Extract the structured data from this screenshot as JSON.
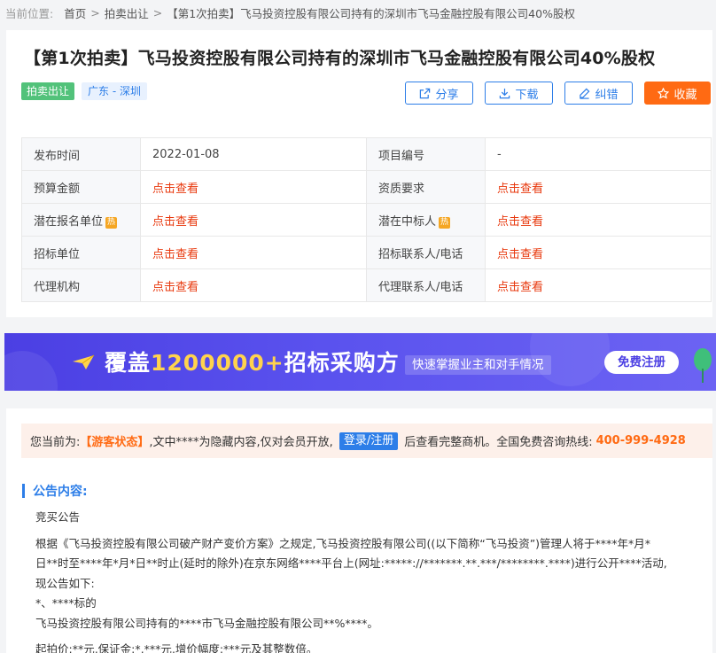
{
  "breadcrumb": {
    "label": "当前位置:",
    "home": "首页",
    "category": "拍卖出让",
    "current": "【第1次拍卖】飞马投资控股有限公司持有的深圳市飞马金融控股有限公司40%股权"
  },
  "header": {
    "title": "【第1次拍卖】飞马投资控股有限公司持有的深圳市飞马金融控股有限公司40%股权",
    "tag_type": "拍卖出让",
    "tag_region": "广东 - 深圳",
    "share_label": "分享",
    "download_label": "下载",
    "correct_label": "纠错",
    "favorite_label": "收藏"
  },
  "info_table": {
    "hot_badge": "热",
    "rows": [
      {
        "k1": "发布时间",
        "v1": "2022-01-08",
        "k2": "项目编号",
        "v2": "-"
      },
      {
        "k1": "预算金额",
        "v1": "点击查看",
        "k2": "资质要求",
        "v2": "点击查看"
      },
      {
        "k1": "潜在报名单位",
        "v1": "点击查看",
        "k2": "潜在中标人",
        "v2": "点击查看"
      },
      {
        "k1": "招标单位",
        "v1": "点击查看",
        "k2": "招标联系人/电话",
        "v2": "点击查看"
      },
      {
        "k1": "代理机构",
        "v1": "点击查看",
        "k2": "代理联系人/电话",
        "v2": "点击查看"
      }
    ]
  },
  "banner": {
    "main_prefix": "覆盖",
    "main_number": "1200000+",
    "main_suffix": "招标采购方",
    "sub": "快速掌握业主和对手情况",
    "button": "免费注册"
  },
  "notice": {
    "prefix": "您当前为:",
    "status": "【游客状态】",
    "middle": ",文中****为隐藏内容,仅对会员开放,",
    "login": "登录/注册",
    "after": "后查看完整商机。全国免费咨询热线:",
    "phone": "400-999-4928"
  },
  "announcement": {
    "section_title": "公告内容:",
    "lines": [
      "竞买公告",
      "根据《飞马投资控股有限公司破产财产变价方案》之规定,飞马投资控股有限公司((以下简称“飞马投资”)管理人将于****年*月*",
      "日**时至****年*月*日**时止(延时的除外)在京东网络****平台上(网址:*****://*******.**.***/********.****)进行公开****活动,",
      "现公告如下:",
      "*、****标的",
      "飞马投资控股有限公司持有的****市飞马金融控股有限公司**%****。",
      "起拍价:**元,保证金:*,***元,增价幅度:***元及其整数倍。"
    ]
  },
  "colors": {
    "accent": "#2d7ee8",
    "orange": "#ff6a13",
    "link_red": "#e8380d",
    "tag_green": "#52c27a",
    "banner_purple": "#4b3fe3"
  }
}
